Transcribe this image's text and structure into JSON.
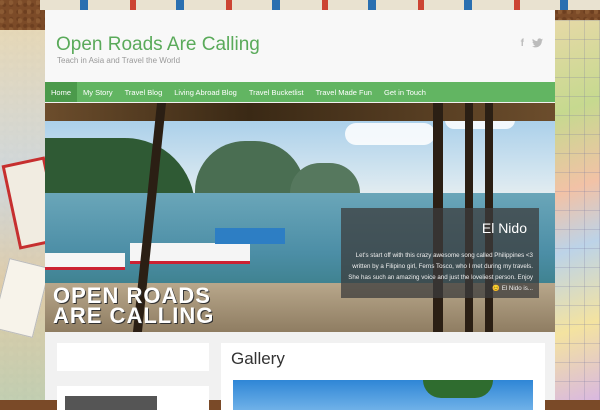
{
  "site": {
    "title": "Open Roads Are Calling",
    "tagline": "Teach in Asia and Travel the World"
  },
  "social": {
    "facebook_glyph": "f",
    "twitter_glyph": "w"
  },
  "nav": {
    "items": [
      {
        "label": "Home",
        "active": true
      },
      {
        "label": "My Story"
      },
      {
        "label": "Travel Blog"
      },
      {
        "label": "Living Abroad Blog"
      },
      {
        "label": "Travel Bucketlist"
      },
      {
        "label": "Travel Made Fun"
      },
      {
        "label": "Get in Touch"
      }
    ]
  },
  "slider": {
    "overlay_line1": "OPEN ROADS",
    "overlay_line2": "ARE CALLING",
    "caption_title": "El Nido",
    "caption_body": "Let's start off with this crazy awesome song called Philippines <3 written by a Filipino girl, Ferns Tosco, who I met during my travels. She has such an amazing voice and just the loveliest person. Enjoy 😊 El Nido is..."
  },
  "main": {
    "section_title": "Gallery"
  },
  "colors": {
    "accent": "#62b562",
    "title": "#5aaa5a"
  }
}
